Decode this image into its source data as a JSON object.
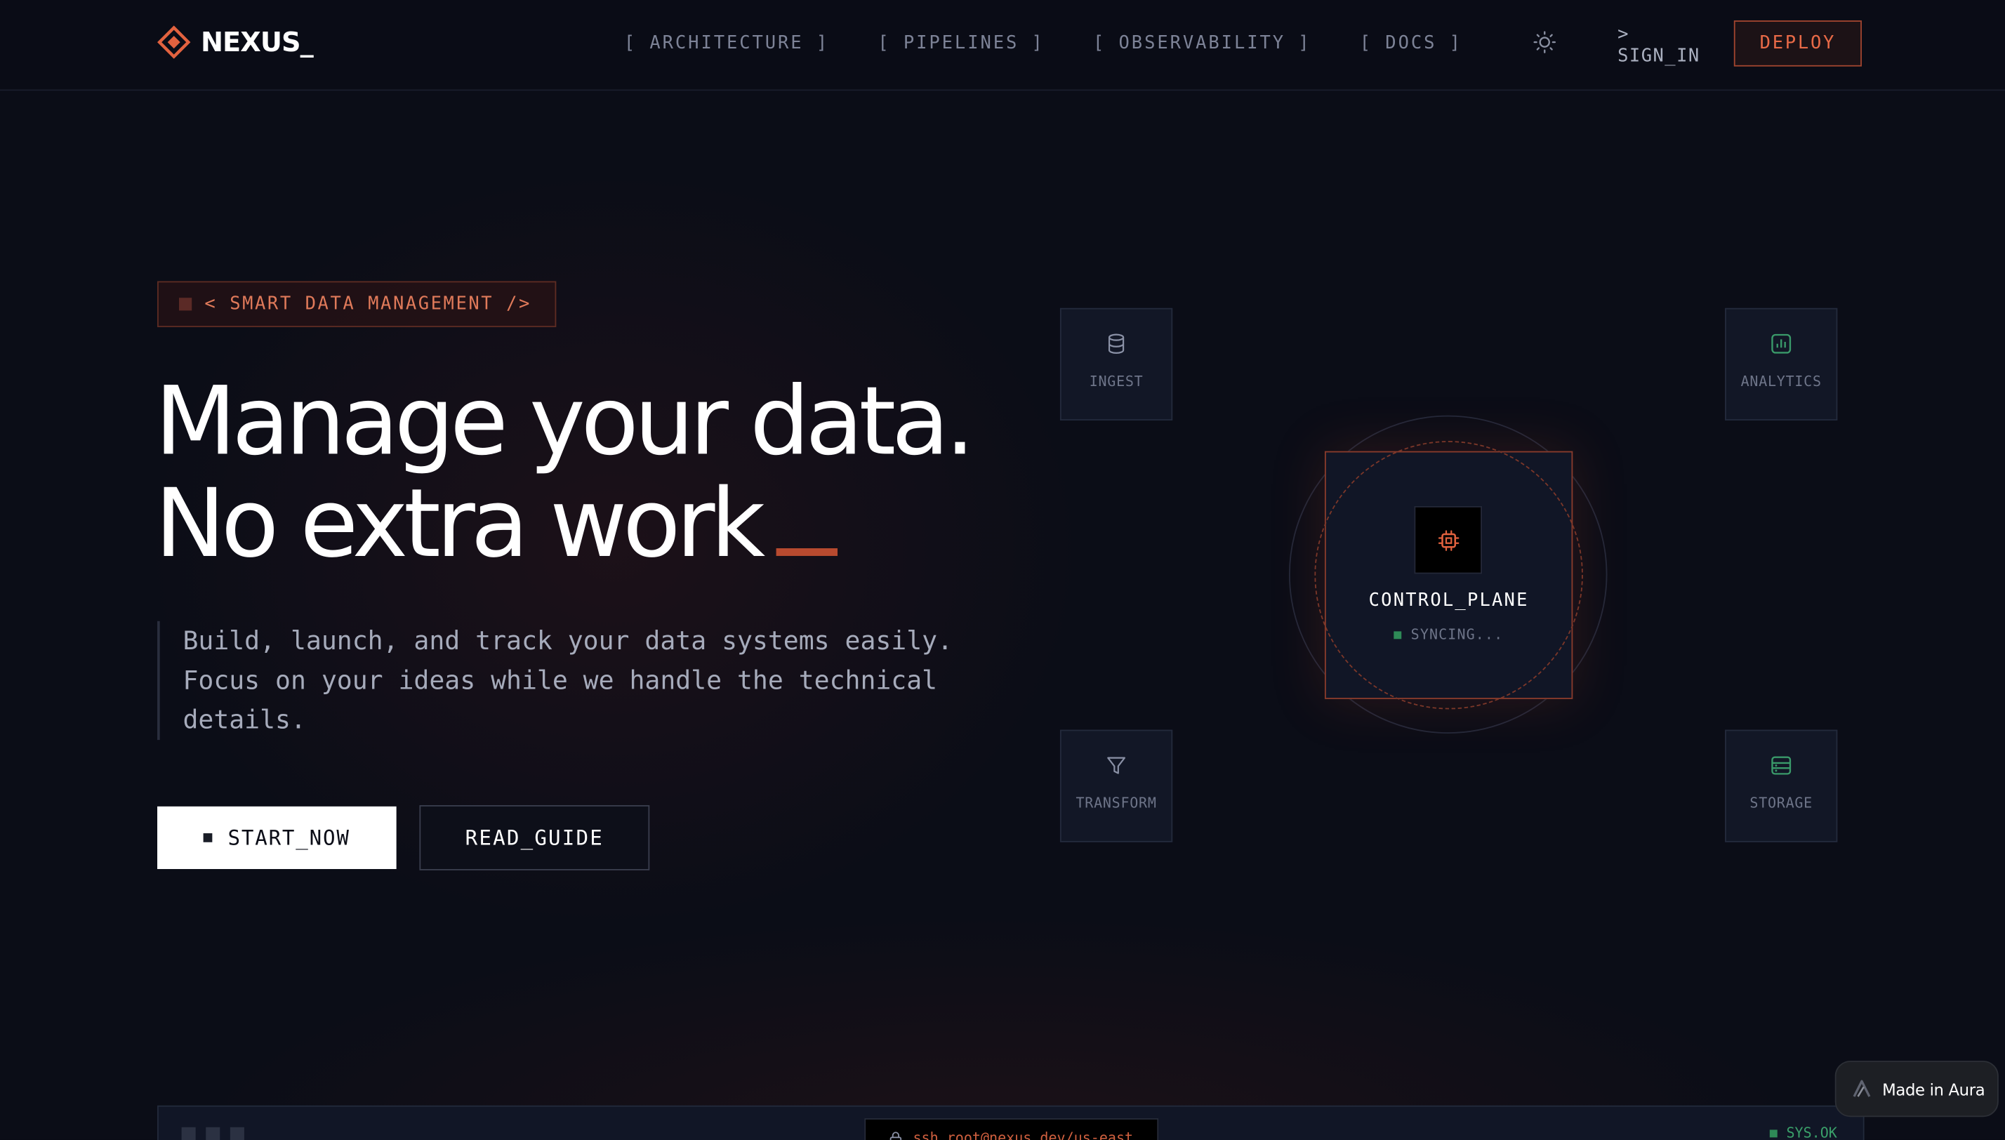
{
  "nav": {
    "logo_text": "NEXUS_",
    "links": [
      "[ ARCHITECTURE ]",
      "[ PIPELINES ]",
      "[ OBSERVABILITY ]",
      "[ DOCS ]"
    ],
    "signin": "> SIGN_IN",
    "deploy": "DEPLOY"
  },
  "hero": {
    "badge": "< SMART DATA MANAGEMENT />",
    "headline_line1": "Manage your data.",
    "headline_line2": "No extra work",
    "lede": "Build, launch, and track your data systems easily. Focus on your ideas while we handle the technical details.",
    "cta_primary": "START_NOW",
    "cta_secondary": "READ_GUIDE"
  },
  "diagram": {
    "nodes": {
      "ingest": "INGEST",
      "analytics": "ANALYTICS",
      "transform": "TRANSFORM",
      "storage": "STORAGE"
    },
    "control_title": "CONTROL_PLANE",
    "control_status": "SYNCING..."
  },
  "terminal": {
    "address": "ssh root@nexus.dev/us-east",
    "status": "SYS.OK"
  },
  "badge_aura": "Made in Aura",
  "colors": {
    "background": "#0b0d17",
    "accent": "#e86a47",
    "status_green": "#2e8a57"
  }
}
